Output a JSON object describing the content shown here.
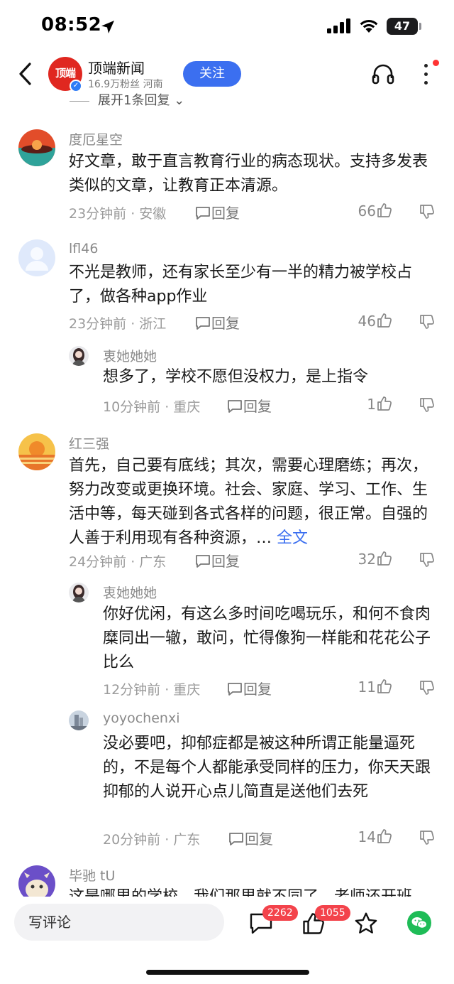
{
  "status_bar": {
    "time": "08:52",
    "battery": "47"
  },
  "header": {
    "brand_logo_text": "顶端",
    "account_name": "顶端新闻",
    "account_meta": "16.9万粉丝 河南",
    "follow_label": "关注"
  },
  "partial_expand": "展开1条回复",
  "comments": [
    {
      "user": "度厄星空",
      "text": "好文章，敢于直言教育行业的病态现状。支持多发表类似的文章，让教育正本清源。",
      "meta": "23分钟前 · 安徽",
      "reply_label": "回复",
      "likes": "66"
    },
    {
      "user": "lfl46",
      "text": "不光是教师，还有家长至少有一半的精力被学校占了，做各种app作业",
      "meta": "23分钟前 · 浙江",
      "reply_label": "回复",
      "likes": "46",
      "replies": [
        {
          "user": "衷她她她",
          "text": "想多了，学校不愿但没权力，是上指令",
          "meta": "10分钟前 · 重庆",
          "reply_label": "回复",
          "likes": "1"
        }
      ]
    },
    {
      "user": "红三强",
      "text": "首先，自己要有底线；其次，需要心理磨练；再次，努力改变或更换环境。社会、家庭、学习、工作、生活中等，每天碰到各式各样的问题，很正常。自强的人善于利用现有各种资源，…",
      "fulltext_label": "全文",
      "meta": "24分钟前 · 广东",
      "reply_label": "回复",
      "likes": "32",
      "replies": [
        {
          "user": "衷她她她",
          "text": "你好优闲，有这么多时间吃喝玩乐，和何不食肉糜同出一辙，敢问，忙得像狗一样能和花花公子比么",
          "meta": "12分钟前 · 重庆",
          "reply_label": "回复",
          "likes": "11"
        },
        {
          "user": "yoyochenxi",
          "text": "没必要吧，抑郁症都是被这种所谓正能量逼死的，不是每个人都能承受同样的压力，你天天跟抑郁的人说开心点儿简直是送他们去死",
          "meta": "20分钟前 · 广东",
          "reply_label": "回复",
          "likes": "14"
        }
      ]
    },
    {
      "user": "毕驰 tU",
      "text": "这是哪里的学校，我们那里就不同了，老师还开班"
    }
  ],
  "bottom_bar": {
    "input_placeholder": "写评论",
    "comment_count": "2262",
    "like_count": "1055"
  },
  "colors": {
    "accent": "#3b6ff0",
    "badge": "#f3434b",
    "brand": "#e02720",
    "wechat": "#1fbc57"
  }
}
